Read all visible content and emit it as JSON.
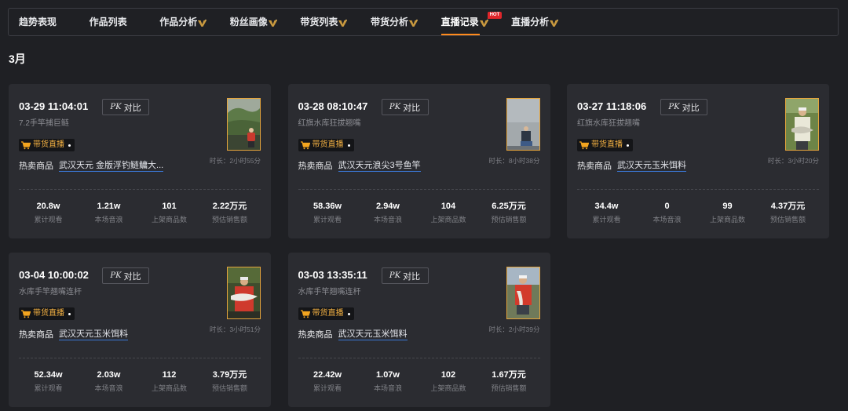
{
  "nav": {
    "tabs": [
      {
        "label": "趋势表现",
        "active": false
      },
      {
        "label": "作品列表",
        "active": false
      },
      {
        "label": "作品分析",
        "active": false,
        "icon": "vip-icon"
      },
      {
        "label": "粉丝画像",
        "active": false,
        "icon": "vip-icon"
      },
      {
        "label": "带货列表",
        "active": false,
        "icon": "vip-icon"
      },
      {
        "label": "带货分析",
        "active": false,
        "icon": "vip-icon"
      },
      {
        "label": "直播记录",
        "active": true,
        "icon": "vip-icon",
        "badge": "HOT"
      },
      {
        "label": "直播分析",
        "active": false,
        "icon": "vip-icon"
      }
    ]
  },
  "month_label": "3月",
  "labels": {
    "pk_prefix": "PK",
    "pk_text": "对比",
    "live_badge": "带货直播",
    "hot_products": "热卖商品",
    "stat_labels": [
      "累计观看",
      "本场音浪",
      "上架商品数",
      "预估销售额"
    ]
  },
  "icons": {
    "tab_badge": "vip-icon",
    "live_badge": "cart-icon"
  },
  "colors": {
    "background": "#1f2024",
    "card": "#2b2c31",
    "active_tab_underline": "#ff8a1c",
    "hot_badge": "#e0262b",
    "vip_gold": "#c9993f",
    "live_badge_text": "#f6b343",
    "link_underline": "#3a78d6",
    "thumbnail_border": "#e5a53c"
  },
  "records": [
    {
      "datetime": "03-29 11:04:01",
      "title": "7.2手竿捕巨鲢",
      "hot_product": "武汉天元 金版浮钓鲢鳙大...",
      "duration": "时长：2小时55分",
      "stats": [
        "20.8w",
        "1.21w",
        "101",
        "2.22万元"
      ]
    },
    {
      "datetime": "03-28 08:10:47",
      "title": "红旗水库狂拔翘嘴",
      "hot_product": "武汉天元浪尖3号鱼竿",
      "duration": "时长：8小时38分",
      "stats": [
        "58.36w",
        "2.94w",
        "104",
        "6.25万元"
      ]
    },
    {
      "datetime": "03-27 11:18:06",
      "title": "红旗水库狂拔翘嘴",
      "hot_product": "武汉天元玉米饵料",
      "duration": "时长：3小时20分",
      "stats": [
        "34.4w",
        "0",
        "99",
        "4.37万元"
      ]
    },
    {
      "datetime": "03-04 10:00:02",
      "title": "水库手竿翘嘴连杆",
      "hot_product": "武汉天元玉米饵料",
      "duration": "时长：3小时51分",
      "stats": [
        "52.34w",
        "2.03w",
        "112",
        "3.79万元"
      ]
    },
    {
      "datetime": "03-03 13:35:11",
      "title": "水库手竿翘嘴连杆",
      "hot_product": "武汉天元玉米饵料",
      "duration": "时长：2小时39分",
      "stats": [
        "22.42w",
        "1.07w",
        "102",
        "1.67万元"
      ]
    }
  ]
}
